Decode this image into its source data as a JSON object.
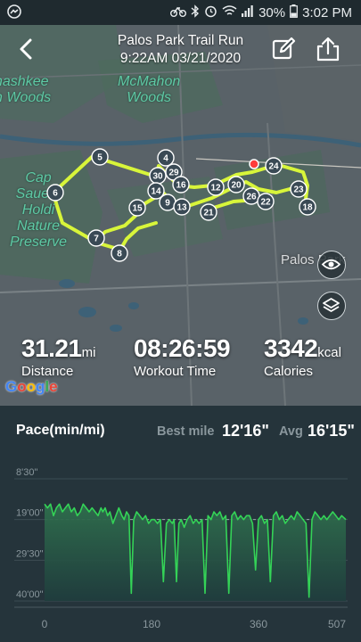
{
  "status_bar": {
    "battery": "30%",
    "time": "3:02 PM",
    "icons": [
      "messenger-icon",
      "bike-icon",
      "bluetooth-icon",
      "alarm-icon",
      "wifi-icon",
      "signal-icon",
      "battery-icon"
    ]
  },
  "header": {
    "title": "Palos Park Trail Run",
    "datetime": "9:22AM 03/21/2020",
    "back_icon": "chevron-left-icon",
    "edit_icon": "edit-icon",
    "share_icon": "share-icon"
  },
  "map": {
    "labels": {
      "ashkee": "nashkee\nn Woods",
      "mcmahon": "McMahon\nWoods",
      "cap_sauers": "Cap Sauers\nHoldi Nature\nPreserve",
      "palos": "Palos Park"
    },
    "markers": [
      "5",
      "4",
      "29",
      "30",
      "14",
      "16",
      "12",
      "20",
      "6",
      "15",
      "9",
      "13",
      "21",
      "26",
      "22",
      "24",
      "23",
      "18",
      "7",
      "8"
    ],
    "view_toggle_icon": "eye-icon",
    "layers_icon": "layers-icon",
    "attribution": "Google"
  },
  "stats": {
    "distance": {
      "value": "31.21",
      "unit": "mi",
      "label": "Distance"
    },
    "workout_time": {
      "value": "08:26:59",
      "label": "Workout Time"
    },
    "calories": {
      "value": "3342",
      "unit": "kcal",
      "label": "Calories"
    }
  },
  "pace": {
    "title": "Pace(min/mi)",
    "best_label": "Best mile",
    "best_value": "12'16\"",
    "avg_label": "Avg",
    "avg_value": "16'15\""
  },
  "colors": {
    "route": "#d8f53a",
    "pace_line": "#34d357",
    "panel_bg": "#25343b"
  },
  "chart_data": {
    "type": "area",
    "title": "Pace(min/mi)",
    "xlabel": "",
    "ylabel": "",
    "x_ticks": [
      "0",
      "180",
      "360",
      "507"
    ],
    "y_ticks": [
      "8'30\"",
      "19'00\"",
      "29'30\"",
      "40'00\""
    ],
    "xlim": [
      0,
      507
    ],
    "ylim_minutes": [
      8.5,
      40
    ],
    "y_inverted": true,
    "series": [
      {
        "x": [
          0,
          5,
          10,
          15,
          20,
          25,
          30,
          35,
          40,
          45,
          50,
          55,
          60,
          65,
          70,
          75,
          80,
          85,
          90,
          95,
          98,
          102,
          106,
          110,
          115,
          120,
          125,
          130,
          134,
          138,
          142,
          146,
          150,
          155,
          160,
          165,
          170,
          175,
          180,
          185,
          190,
          195,
          200,
          205,
          210,
          215,
          218,
          222,
          226,
          230,
          235,
          240,
          245,
          250,
          255,
          260,
          265,
          270,
          275,
          280,
          285,
          290,
          295,
          300,
          305,
          310,
          315,
          320,
          325,
          330,
          335,
          340,
          345,
          350,
          355,
          360,
          365,
          370,
          375,
          380,
          385,
          390,
          395,
          400,
          405,
          410,
          415,
          420,
          425,
          430,
          435,
          440,
          445,
          450,
          455,
          460,
          465,
          470,
          475,
          480,
          485,
          490,
          495,
          500,
          507
        ],
        "y_minutes": [
          15,
          16,
          15,
          18,
          16,
          15,
          17,
          16,
          15,
          17,
          16,
          18,
          17,
          15,
          16,
          17,
          16,
          17,
          18,
          16,
          17,
          16,
          18,
          17,
          20,
          18,
          16,
          18,
          19,
          17,
          18,
          38,
          19,
          17,
          18,
          19,
          18,
          20,
          19,
          19,
          20,
          19,
          35,
          20,
          19,
          20,
          19,
          35,
          20,
          19,
          21,
          19,
          18,
          20,
          19,
          20,
          19,
          38,
          18,
          19,
          17,
          18,
          17,
          19,
          18,
          38,
          18,
          17,
          19,
          18,
          19,
          18,
          18,
          20,
          32,
          19,
          18,
          20,
          19,
          35,
          18,
          17,
          19,
          18,
          20,
          19,
          18,
          19,
          17,
          18,
          19,
          20,
          39,
          19,
          17,
          18,
          19,
          18,
          19,
          18,
          17,
          18,
          19,
          18,
          19
        ]
      }
    ],
    "reference_line_minutes": 19,
    "grid": true
  }
}
